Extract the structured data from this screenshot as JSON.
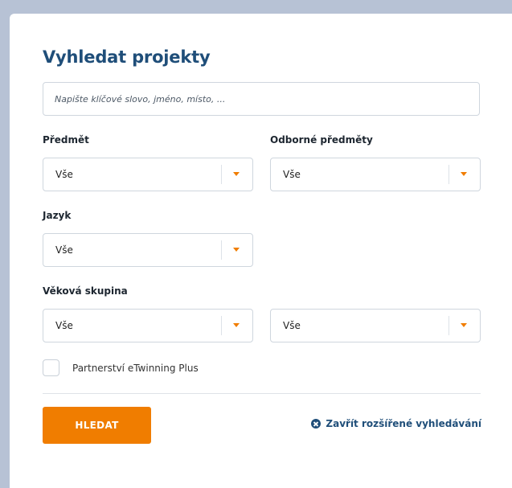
{
  "form": {
    "title": "Vyhledat projekty",
    "search_placeholder": "Napište klíčové slovo, jméno, místo, ...",
    "subject": {
      "label": "Předmět",
      "value": "Vše"
    },
    "vocational_subjects": {
      "label": "Odborné předměty",
      "value": "Vše"
    },
    "language": {
      "label": "Jazyk",
      "value": "Vše"
    },
    "age_group": {
      "label": "Věková skupina",
      "from_value": "Vše",
      "to_value": "Vše"
    },
    "partnership_checkbox": {
      "label": "Partnerství eTwinning Plus",
      "checked": false
    },
    "search_button": "HLEDAT",
    "close_advanced_link": "Zavřít rozšířené vyhledávání"
  },
  "colors": {
    "accent": "#f07d00",
    "title": "#1f4e79",
    "background": "#b7c2d5"
  },
  "icons": {
    "dropdown": "caret-down-icon",
    "close": "close-circle-icon"
  }
}
